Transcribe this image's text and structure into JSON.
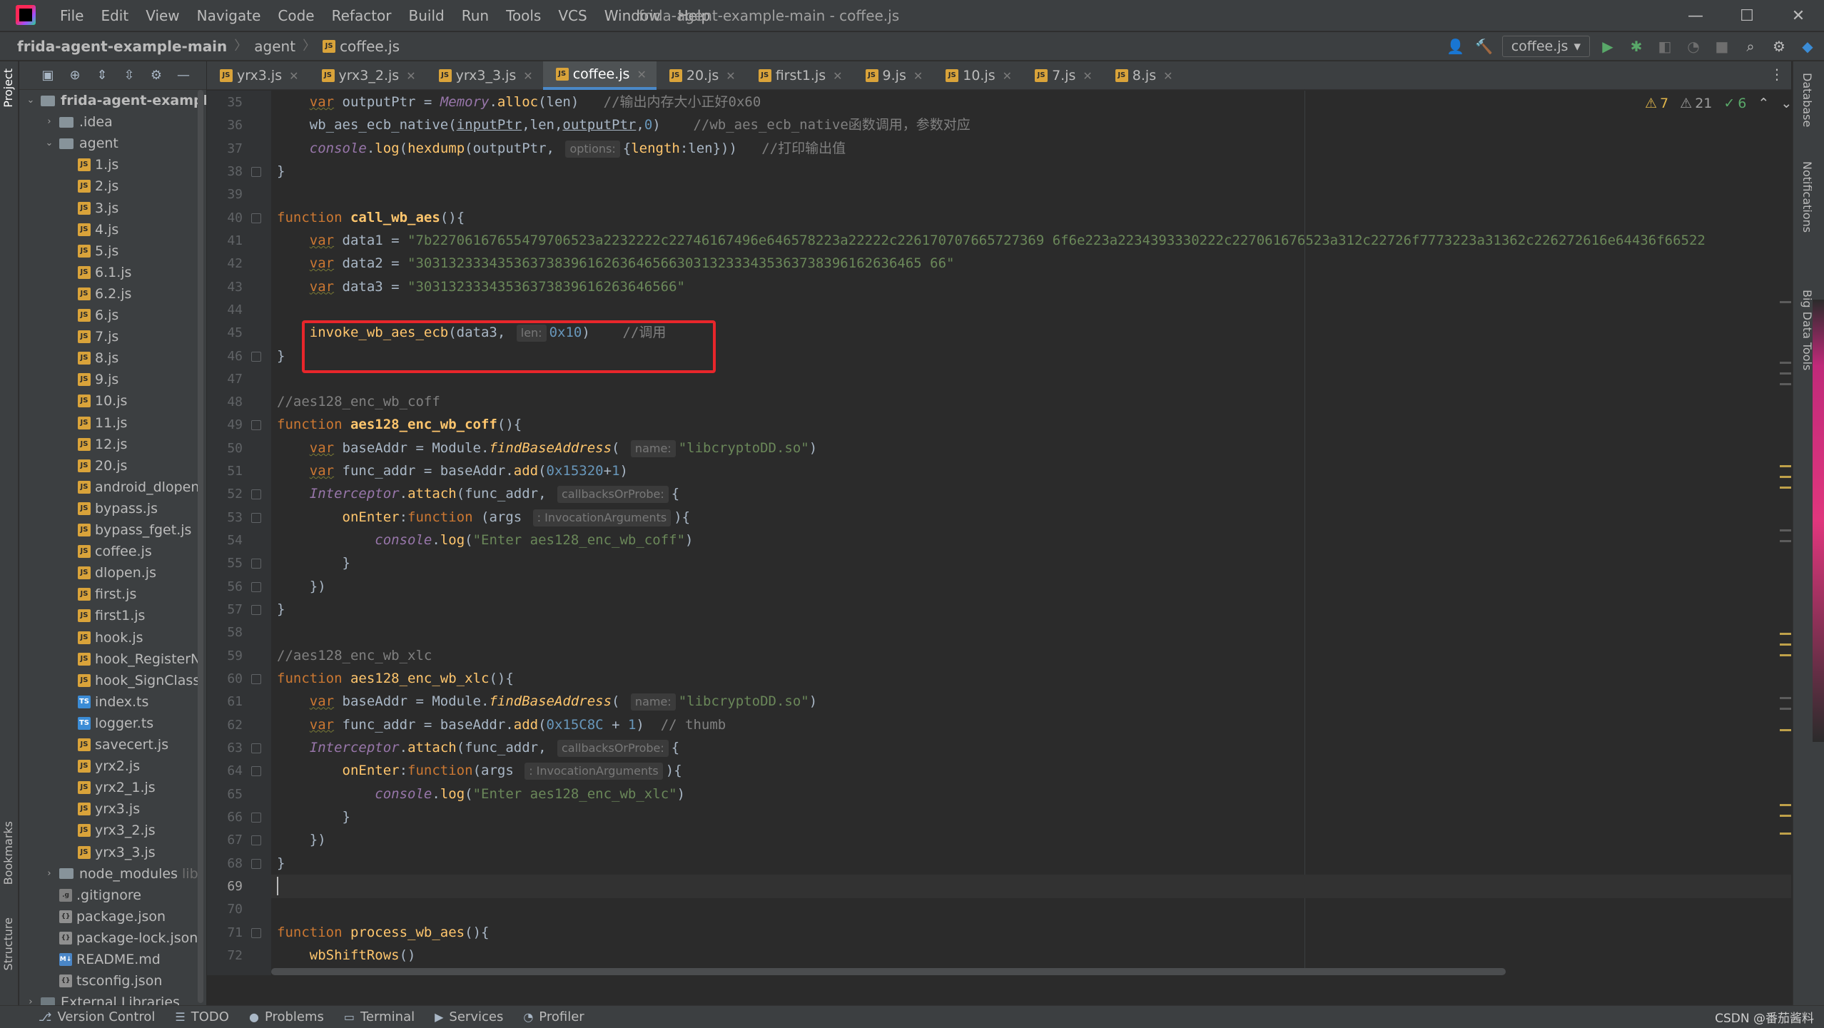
{
  "window": {
    "title": "frida-agent-example-main - coffee.js",
    "minimize": "—",
    "maximize": "☐",
    "close": "✕"
  },
  "menu": [
    "File",
    "Edit",
    "View",
    "Navigate",
    "Code",
    "Refactor",
    "Build",
    "Run",
    "Tools",
    "VCS",
    "Window",
    "Help"
  ],
  "breadcrumb": {
    "project": "frida-agent-example-main",
    "folder": "agent",
    "file": "coffee.js"
  },
  "run_config": {
    "label": "coffee.js"
  },
  "left_strip": {
    "project": "Project",
    "bookmarks": "Bookmarks",
    "structure": "Structure"
  },
  "right_strip": {
    "database": "Database",
    "notifications": "Notifications",
    "bigdata": "Big Data Tools"
  },
  "tree": [
    {
      "label": "frida-agent-example-main",
      "type": "folder",
      "indent": 0,
      "open": true,
      "bold": true
    },
    {
      "label": ".idea",
      "type": "folder",
      "indent": 1,
      "open": false
    },
    {
      "label": "agent",
      "type": "folder",
      "indent": 1,
      "open": true
    },
    {
      "label": "1.js",
      "type": "js",
      "indent": 2
    },
    {
      "label": "2.js",
      "type": "js",
      "indent": 2
    },
    {
      "label": "3.js",
      "type": "js",
      "indent": 2
    },
    {
      "label": "4.js",
      "type": "js",
      "indent": 2
    },
    {
      "label": "5.js",
      "type": "js",
      "indent": 2
    },
    {
      "label": "6.1.js",
      "type": "js",
      "indent": 2
    },
    {
      "label": "6.2.js",
      "type": "js",
      "indent": 2
    },
    {
      "label": "6.js",
      "type": "js",
      "indent": 2
    },
    {
      "label": "7.js",
      "type": "js",
      "indent": 2
    },
    {
      "label": "8.js",
      "type": "js",
      "indent": 2
    },
    {
      "label": "9.js",
      "type": "js",
      "indent": 2
    },
    {
      "label": "10.js",
      "type": "js",
      "indent": 2
    },
    {
      "label": "11.js",
      "type": "js",
      "indent": 2
    },
    {
      "label": "12.js",
      "type": "js",
      "indent": 2
    },
    {
      "label": "20.js",
      "type": "js",
      "indent": 2
    },
    {
      "label": "android_dlopen",
      "type": "js",
      "indent": 2
    },
    {
      "label": "bypass.js",
      "type": "js",
      "indent": 2
    },
    {
      "label": "bypass_fget.js",
      "type": "js",
      "indent": 2
    },
    {
      "label": "coffee.js",
      "type": "js",
      "indent": 2
    },
    {
      "label": "dlopen.js",
      "type": "js",
      "indent": 2
    },
    {
      "label": "first.js",
      "type": "js",
      "indent": 2
    },
    {
      "label": "first1.js",
      "type": "js",
      "indent": 2
    },
    {
      "label": "hook.js",
      "type": "js",
      "indent": 2
    },
    {
      "label": "hook_RegisterN",
      "type": "js",
      "indent": 2
    },
    {
      "label": "hook_SignClass",
      "type": "js",
      "indent": 2
    },
    {
      "label": "index.ts",
      "type": "ts",
      "indent": 2
    },
    {
      "label": "logger.ts",
      "type": "ts",
      "indent": 2
    },
    {
      "label": "savecert.js",
      "type": "js",
      "indent": 2
    },
    {
      "label": "yrx2.js",
      "type": "js",
      "indent": 2
    },
    {
      "label": "yrx2_1.js",
      "type": "js",
      "indent": 2
    },
    {
      "label": "yrx3.js",
      "type": "js",
      "indent": 2
    },
    {
      "label": "yrx3_2.js",
      "type": "js",
      "indent": 2
    },
    {
      "label": "yrx3_3.js",
      "type": "js",
      "indent": 2
    },
    {
      "label": "node_modules",
      "type": "folder",
      "indent": 1,
      "open": false,
      "suffix": "lib"
    },
    {
      "label": ".gitignore",
      "type": "git",
      "indent": 1
    },
    {
      "label": "package.json",
      "type": "json",
      "indent": 1
    },
    {
      "label": "package-lock.json",
      "type": "json",
      "indent": 1
    },
    {
      "label": "README.md",
      "type": "md",
      "indent": 1
    },
    {
      "label": "tsconfig.json",
      "type": "json",
      "indent": 1
    },
    {
      "label": "External Libraries",
      "type": "lib",
      "indent": 0,
      "open": false
    }
  ],
  "tabs": [
    {
      "label": "yrx3.js",
      "active": false
    },
    {
      "label": "yrx3_2.js",
      "active": false
    },
    {
      "label": "yrx3_3.js",
      "active": false
    },
    {
      "label": "coffee.js",
      "active": true
    },
    {
      "label": "20.js",
      "active": false
    },
    {
      "label": "first1.js",
      "active": false
    },
    {
      "label": "9.js",
      "active": false
    },
    {
      "label": "10.js",
      "active": false
    },
    {
      "label": "7.js",
      "active": false
    },
    {
      "label": "8.js",
      "active": false
    }
  ],
  "inspections": {
    "warnings": "7",
    "weak_warnings": "21",
    "ok": "6"
  },
  "code": {
    "first_line": 35,
    "caret_line": 69,
    "lines": [
      [
        [
          "    ",
          ""
        ],
        [
          "var",
          "var-kw"
        ],
        [
          " outputPtr = ",
          ""
        ],
        [
          "Memory",
          "cls"
        ],
        [
          ".",
          ""
        ],
        [
          "alloc",
          "fn"
        ],
        [
          "(len)   ",
          ""
        ],
        [
          "//输出内存大小正好0x60",
          "cmt"
        ]
      ],
      [
        [
          "    ",
          ""
        ],
        [
          "wb_aes_ecb_native",
          "plain"
        ],
        [
          "(",
          ""
        ],
        [
          "inputPtr",
          "underl"
        ],
        [
          ",len,",
          ""
        ],
        [
          "outputPtr",
          "underl"
        ],
        [
          ",",
          ""
        ],
        [
          "0",
          "num"
        ],
        [
          ")    ",
          ""
        ],
        [
          "//wb_aes_ecb_native函数调用，参数对应",
          "cmt"
        ]
      ],
      [
        [
          "    ",
          ""
        ],
        [
          "console",
          "cls"
        ],
        [
          ".",
          ""
        ],
        [
          "log",
          "fn"
        ],
        [
          "(",
          ""
        ],
        [
          "hexdump",
          "fn"
        ],
        [
          "(outputPtr, ",
          ""
        ],
        [
          "options:",
          "hint"
        ],
        [
          "{",
          ""
        ],
        [
          "length",
          "prop"
        ],
        [
          ":len}))   ",
          ""
        ],
        [
          "//打印输出值",
          "cmt"
        ]
      ],
      [
        [
          "}",
          ""
        ]
      ],
      [
        [
          "",
          ""
        ]
      ],
      [
        [
          "function",
          "kw"
        ],
        [
          " ",
          ""
        ],
        [
          "call_wb_aes",
          "fnb"
        ],
        [
          "(){",
          ""
        ]
      ],
      [
        [
          "    ",
          ""
        ],
        [
          "var",
          "var-kw"
        ],
        [
          " data1 = ",
          ""
        ],
        [
          "\"7b22706167655479706523a2232222c22746167496e646578223a22222c226170707665727369 6f6e223a2234393330222c227061676523a312c22726f7773223a31362c226272616e64436f66522",
          "str"
        ]
      ],
      [
        [
          "    ",
          ""
        ],
        [
          "var",
          "var-kw"
        ],
        [
          " data2 = ",
          ""
        ],
        [
          "\"30313233343536373839616263646566303132333435363738396162636465 66\"",
          "str"
        ]
      ],
      [
        [
          "    ",
          ""
        ],
        [
          "var",
          "var-kw"
        ],
        [
          " data3 = ",
          ""
        ],
        [
          "\"30313233343536373839616263646566\"",
          "str"
        ]
      ],
      [
        [
          "",
          ""
        ]
      ],
      [
        [
          "    ",
          ""
        ],
        [
          "invoke_wb_aes_ecb",
          "fn"
        ],
        [
          "(data3, ",
          ""
        ],
        [
          "len:",
          "hint"
        ],
        [
          "0x10",
          "num"
        ],
        [
          ")    ",
          ""
        ],
        [
          "//调用",
          "cmt"
        ]
      ],
      [
        [
          "}",
          ""
        ]
      ],
      [
        [
          "",
          ""
        ]
      ],
      [
        [
          "//aes128_enc_wb_coff",
          "cmt"
        ]
      ],
      [
        [
          "function",
          "kw"
        ],
        [
          " ",
          ""
        ],
        [
          "aes128_enc_wb_coff",
          "fnb"
        ],
        [
          "(){",
          ""
        ]
      ],
      [
        [
          "    ",
          ""
        ],
        [
          "var",
          "var-kw"
        ],
        [
          " baseAddr = Module.",
          ""
        ],
        [
          "findBaseAddress",
          "mth"
        ],
        [
          "( ",
          ""
        ],
        [
          "name:",
          "hint"
        ],
        [
          "\"libcryptoDD.so\"",
          "str"
        ],
        [
          ")",
          ""
        ]
      ],
      [
        [
          "    ",
          ""
        ],
        [
          "var",
          "var-kw"
        ],
        [
          " func_addr = baseAddr.",
          ""
        ],
        [
          "add",
          "fn"
        ],
        [
          "(",
          ""
        ],
        [
          "0x15320",
          "num"
        ],
        [
          "+",
          ""
        ],
        [
          "1",
          "num"
        ],
        [
          ")",
          ""
        ]
      ],
      [
        [
          "    ",
          ""
        ],
        [
          "Interceptor",
          "cls"
        ],
        [
          ".",
          ""
        ],
        [
          "attach",
          "fn"
        ],
        [
          "(func_addr, ",
          ""
        ],
        [
          "callbacksOrProbe:",
          "hint"
        ],
        [
          "{",
          ""
        ]
      ],
      [
        [
          "        ",
          ""
        ],
        [
          "onEnter",
          "prop"
        ],
        [
          ":",
          ""
        ],
        [
          "function",
          "kw"
        ],
        [
          " (args ",
          ""
        ],
        [
          ": InvocationArguments",
          "hint"
        ],
        [
          "){",
          ""
        ]
      ],
      [
        [
          "            ",
          ""
        ],
        [
          "console",
          "cls"
        ],
        [
          ".",
          ""
        ],
        [
          "log",
          "fn"
        ],
        [
          "(",
          ""
        ],
        [
          "\"Enter aes128_enc_wb_coff\"",
          "str"
        ],
        [
          ")",
          ""
        ]
      ],
      [
        [
          "        }",
          ""
        ]
      ],
      [
        [
          "    })",
          ""
        ]
      ],
      [
        [
          "}",
          ""
        ]
      ],
      [
        [
          "",
          ""
        ]
      ],
      [
        [
          "//aes128_enc_wb_xlc",
          "cmt"
        ]
      ],
      [
        [
          "function",
          "kw"
        ],
        [
          " ",
          ""
        ],
        [
          "aes128_enc_wb_xlc",
          "fn"
        ],
        [
          "(){",
          ""
        ]
      ],
      [
        [
          "    ",
          ""
        ],
        [
          "var",
          "var-kw"
        ],
        [
          " baseAddr = Module.",
          ""
        ],
        [
          "findBaseAddress",
          "mth"
        ],
        [
          "( ",
          ""
        ],
        [
          "name:",
          "hint"
        ],
        [
          "\"libcryptoDD.so\"",
          "str"
        ],
        [
          ")",
          ""
        ]
      ],
      [
        [
          "    ",
          ""
        ],
        [
          "var",
          "var-kw"
        ],
        [
          " func_addr = baseAddr.",
          ""
        ],
        [
          "add",
          "fn"
        ],
        [
          "(",
          ""
        ],
        [
          "0x15C8C",
          "num"
        ],
        [
          " + ",
          ""
        ],
        [
          "1",
          "num"
        ],
        [
          ")  ",
          ""
        ],
        [
          "// thumb",
          "cmt"
        ]
      ],
      [
        [
          "    ",
          ""
        ],
        [
          "Interceptor",
          "cls"
        ],
        [
          ".",
          ""
        ],
        [
          "attach",
          "fn"
        ],
        [
          "(func_addr, ",
          ""
        ],
        [
          "callbacksOrProbe:",
          "hint"
        ],
        [
          "{",
          ""
        ]
      ],
      [
        [
          "        ",
          ""
        ],
        [
          "onEnter",
          "prop"
        ],
        [
          ":",
          ""
        ],
        [
          "function",
          "kw"
        ],
        [
          "(args ",
          ""
        ],
        [
          ": InvocationArguments",
          "hint"
        ],
        [
          "){",
          ""
        ]
      ],
      [
        [
          "            ",
          ""
        ],
        [
          "console",
          "cls"
        ],
        [
          ".",
          ""
        ],
        [
          "log",
          "fn"
        ],
        [
          "(",
          ""
        ],
        [
          "\"Enter aes128_enc_wb_xlc\"",
          "str"
        ],
        [
          ")",
          ""
        ]
      ],
      [
        [
          "        }",
          ""
        ]
      ],
      [
        [
          "    })",
          ""
        ]
      ],
      [
        [
          "}",
          ""
        ]
      ],
      [
        [
          "",
          ""
        ]
      ],
      [
        [
          "",
          ""
        ]
      ],
      [
        [
          "function",
          "kw"
        ],
        [
          " ",
          ""
        ],
        [
          "process_wb_aes",
          "fn"
        ],
        [
          "(){",
          ""
        ]
      ],
      [
        [
          "    ",
          ""
        ],
        [
          "wbShiftRows",
          "fn"
        ],
        [
          "()",
          ""
        ]
      ]
    ]
  },
  "bottom_tabs": [
    {
      "label": "Version Control",
      "icon": "⎇"
    },
    {
      "label": "TODO",
      "icon": "☰"
    },
    {
      "label": "Problems",
      "icon": "●"
    },
    {
      "label": "Terminal",
      "icon": "▭"
    },
    {
      "label": "Services",
      "icon": "▶"
    },
    {
      "label": "Profiler",
      "icon": "◔"
    }
  ],
  "watermark": "CSDN @番茄酱料"
}
